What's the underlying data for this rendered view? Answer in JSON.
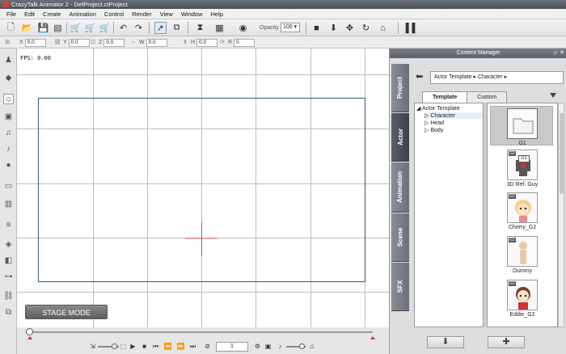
{
  "window": {
    "title": "CrazyTalk Animator 2 - DefProject.ctProject"
  },
  "menu": [
    "File",
    "Edit",
    "Create",
    "Animation",
    "Control",
    "Render",
    "View",
    "Window",
    "Help"
  ],
  "toolbar": {
    "opacity_label": "Opacity :",
    "opacity_value": "100",
    "icons": [
      "new-file-icon",
      "open-folder-icon",
      "save-icon",
      "saveas-icon",
      "cart-icon",
      "cart-icon",
      "cart-icon",
      "film-icon",
      "export-icon",
      "undo-icon",
      "redo-icon",
      "pointer-icon",
      "duplicate-icon",
      "flip-icon",
      "layer-icon",
      "eye-icon",
      "camera-icon",
      "move-down-icon",
      "move-icon",
      "rotate-icon",
      "home-icon",
      "sound-icon"
    ]
  },
  "coords": {
    "x_label": "X",
    "x_value": "0.0",
    "y_label": "Y",
    "y_value": "0.0",
    "z_label": "Z",
    "z_value": "0.0",
    "w_label": "W",
    "w_value": "0.0",
    "h_label": "H",
    "h_value": "0.0",
    "r_label": "R",
    "r_value": "0"
  },
  "stage": {
    "fps": "FPS: 0.00",
    "mode_button": "STAGE MODE"
  },
  "timeline": {
    "frame": "1"
  },
  "content_manager": {
    "title": "Content Manager",
    "vertical_tabs": [
      "Project",
      "Actor",
      "Animation",
      "Scene",
      "SFX"
    ],
    "breadcrumb": "Actor Template ▸  Character ▸",
    "tabs": [
      "Template",
      "Custom"
    ],
    "tree": {
      "root": "Actor Template",
      "children": [
        "Character",
        "Head",
        "Body"
      ]
    },
    "items": [
      {
        "label": "G1",
        "badge": ""
      },
      {
        "label": "3D Ref. Guy",
        "badge": "G2",
        "tooltip": "G1"
      },
      {
        "label": "Cherry_G2",
        "badge": "G2"
      },
      {
        "label": "Dummy",
        "badge": "G2"
      },
      {
        "label": "Eddie_G2",
        "badge": "G2"
      }
    ]
  }
}
